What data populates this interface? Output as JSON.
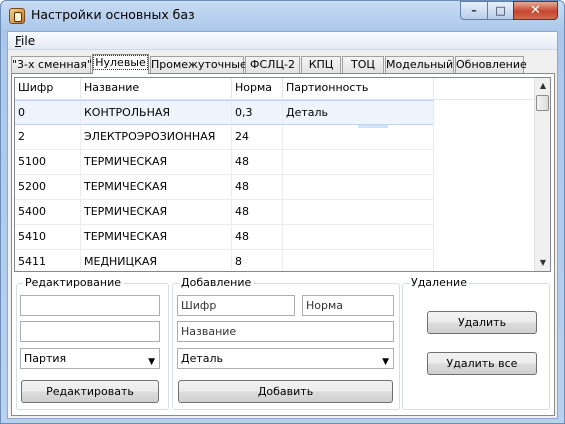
{
  "window": {
    "title": "Настройки основных баз",
    "min": "–",
    "max": "□",
    "close": "✕"
  },
  "menu": {
    "file_key": "F",
    "file_rest": "ile"
  },
  "tabs": [
    "\"3-х сменная\"",
    "Нулевые",
    "Промежуточные",
    "ФСЛЦ-2",
    "КПЦ",
    "ТОЦ",
    "Модельный",
    "Обновление"
  ],
  "grid": {
    "columns": [
      "Шифр",
      "Название",
      "Норма",
      "Партионность"
    ],
    "rows": [
      [
        "0",
        "КОНТРОЛЬНАЯ",
        "0,3",
        "Деталь"
      ],
      [
        "2",
        "ЭЛЕКТРОЭРОЗИОННАЯ",
        "24",
        ""
      ],
      [
        "5100",
        "ТЕРМИЧЕСКАЯ",
        "48",
        ""
      ],
      [
        "5200",
        "ТЕРМИЧЕСКАЯ",
        "48",
        ""
      ],
      [
        "5400",
        "ТЕРМИЧЕСКАЯ",
        "48",
        ""
      ],
      [
        "5410",
        "ТЕРМИЧЕСКАЯ",
        "48",
        ""
      ],
      [
        "5411",
        "МЕДНИЦКАЯ",
        "8",
        ""
      ]
    ],
    "scroll_up": "▲",
    "scroll_down": "▼"
  },
  "edit": {
    "title": "Редактирование",
    "field1": "",
    "field2": "",
    "combo": "Партия",
    "button": "Редактировать"
  },
  "add": {
    "title": "Добавление",
    "code_placeholder": "Шифр",
    "norm_placeholder": "Норма",
    "name_placeholder": "Название",
    "combo": "Деталь",
    "button": "Добавить"
  },
  "remove": {
    "title": "Удаление",
    "delete": "Удалить",
    "delete_all": "Удалить все"
  },
  "combo_arrow": "▼"
}
